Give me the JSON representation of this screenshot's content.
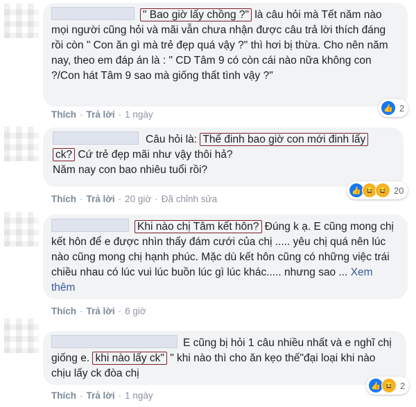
{
  "comments": [
    {
      "highlight": "\" Bao giờ lấy chồng ?\"",
      "text_after": " là câu hỏi mà Tết năm nào mọi người cũng hỏi và mãi vẫn chưa nhận được câu trả lời thích đáng rồi còn \" Con ăn gì mà trẻ đẹp quá vậy ?\" thì hơi bị thừa. Cho nên năm nay, theo em đáp án là : \" CD Tâm 9 có còn cái nào nữa không con ?/Con hát Tâm 9 sao mà giống thất tình vậy ?\"",
      "like_label": "Thích",
      "reply_label": "Trả lời",
      "time": "1 ngày",
      "reaction_count": "2"
    },
    {
      "text_before": "Câu hỏi là: ",
      "highlight": "Thế đinh bao giờ con mới đinh lấy ck?",
      "highlight_part1": "Thế đinh bao giờ con mới đinh lấy",
      "highlight_part2": "ck?",
      "text_after": " Cứ trẻ đẹp mãi như vậy thôi hả?",
      "line2": "Năm nay con bao nhiêu tuổi rồi?",
      "like_label": "Thích",
      "reply_label": "Trả lời",
      "time": "20 giờ",
      "edited": "Đã chỉnh sửa",
      "reaction_count": "20"
    },
    {
      "highlight": "Khi nào chị Tâm kết hôn?",
      "text_after": " Đúng k ạ. E cũng mong chị kết hôn để e được nhìn thấy đám cưới của chị ..... yêu chị quá nên lúc nào cũng mong chị hạnh phúc. Mặc dù kết hôn cũng có những việc trái chiều nhau có lúc vui lúc buồn lúc gì lúc khác..... nhưng sao ... ",
      "see_more": "Xem thêm",
      "like_label": "Thích",
      "reply_label": "Trả lời",
      "time": "6 giờ"
    },
    {
      "text_before": "E cũng bị hỏi 1 câu nhiều nhất và e nghĩ chị giống e. ",
      "highlight": "khi nào lấy ck\"",
      "text_after": " \" khi nào thì cho ăn kẹo thế\"đại loại khi nào chịu lấy ck đòa chị",
      "like_label": "Thích",
      "reply_label": "Trả lời",
      "time": "1 ngày",
      "reaction_count": "2"
    }
  ],
  "colors": {
    "bubble": "#f2f3f5",
    "highlight_border": "#7a1f2b",
    "like_blue": "#1877f2",
    "haha_yellow": "#f7b125"
  },
  "icons": [
    "like-icon",
    "haha-icon"
  ]
}
